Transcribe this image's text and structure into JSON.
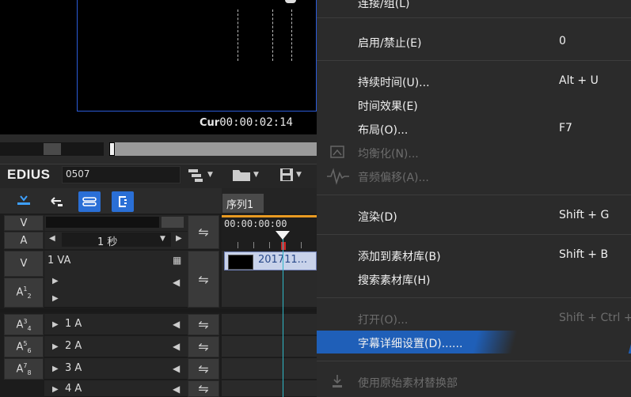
{
  "preview": {
    "timecode_label": "Cur",
    "timecode": "00:00:02:14"
  },
  "toolbar": {
    "app_name": "EDIUS",
    "project_name": "0507"
  },
  "track_panel": {
    "v_label": "V",
    "a_label": "A",
    "zoom_value": "1 秒",
    "sequence_tab": "序列1",
    "ruler_time": "00:00:00:00",
    "clip_label": "201711...",
    "tracks": [
      {
        "patch": "V",
        "name": "1 VA"
      },
      {
        "patch": "A1/2",
        "name": ""
      },
      {
        "patch": "A3/4",
        "name": "1 A"
      },
      {
        "patch": "A5/6",
        "name": "2 A"
      },
      {
        "patch": "A7/8",
        "name": "3 A"
      },
      {
        "patch": "",
        "name": "4 A"
      }
    ]
  },
  "menu": {
    "items": [
      {
        "label": "连接/组(L)",
        "shortcut": "",
        "enabled": true
      },
      {
        "label": "启用/禁止(E)",
        "shortcut": "0",
        "enabled": true
      },
      {
        "label": "持续时间(U)...",
        "shortcut": "Alt + U",
        "enabled": true
      },
      {
        "label": "时间效果(E)",
        "shortcut": "",
        "enabled": true
      },
      {
        "label": "布局(O)...",
        "shortcut": "F7",
        "enabled": true
      },
      {
        "label": "均衡化(N)...",
        "shortcut": "",
        "enabled": false
      },
      {
        "label": "音频偏移(A)...",
        "shortcut": "",
        "enabled": false
      },
      {
        "label": "渲染(D)",
        "shortcut": "Shift + G",
        "enabled": true
      },
      {
        "label": "添加到素材库(B)",
        "shortcut": "Shift + B",
        "enabled": true
      },
      {
        "label": "搜索素材库(H)",
        "shortcut": "",
        "enabled": true
      },
      {
        "label": "打开(O)...",
        "shortcut": "Shift + Ctrl + ...",
        "enabled": false
      },
      {
        "label": "字幕详细设置(D)......",
        "shortcut": "",
        "enabled": true,
        "highlighted": true
      },
      {
        "label": "使用原始素材替换部",
        "shortcut": "",
        "enabled": false
      }
    ]
  },
  "colors": {
    "accent_blue": "#2a6fd6",
    "highlight": "#1f5fb8",
    "playhead": "#2fb8c8",
    "ruler_orange": "#e89a22"
  }
}
